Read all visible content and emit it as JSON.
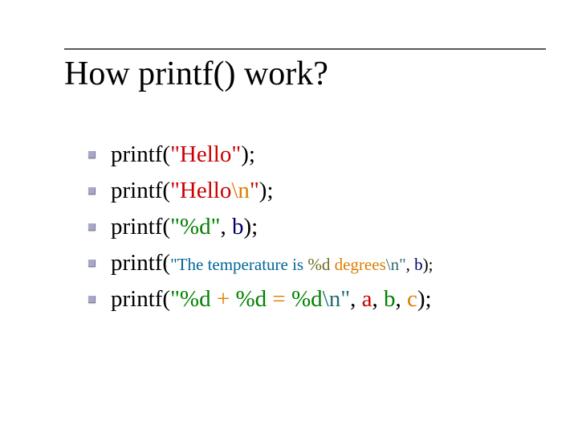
{
  "title": "How printf() work?",
  "lines": {
    "l1": {
      "a": "printf(",
      "b": "\"Hello\"",
      "c": ");"
    },
    "l2": {
      "a": "printf(",
      "b": "\"Hello",
      "c": "\\n",
      "d": "\"",
      "e": ");"
    },
    "l3": {
      "a": "printf(",
      "b": "\"%d\"",
      "c": ", ",
      "d": "b",
      "e": ");"
    },
    "l4": {
      "a": "printf(",
      "b": "\"The temperature is ",
      "c": "%d ",
      "d": "degrees",
      "e": "\\n\"",
      "f": ", ",
      "g": "b",
      "h": ");"
    },
    "l5": {
      "a": "printf(",
      "b": "\"%d",
      "c": " + ",
      "d": "%d",
      "e": " = ",
      "f": "%d",
      "g": "\\n\"",
      "h": ", ",
      "i": "a",
      "j": ", ",
      "k": "b",
      "l": ", ",
      "m": "c",
      "n": ");"
    }
  }
}
